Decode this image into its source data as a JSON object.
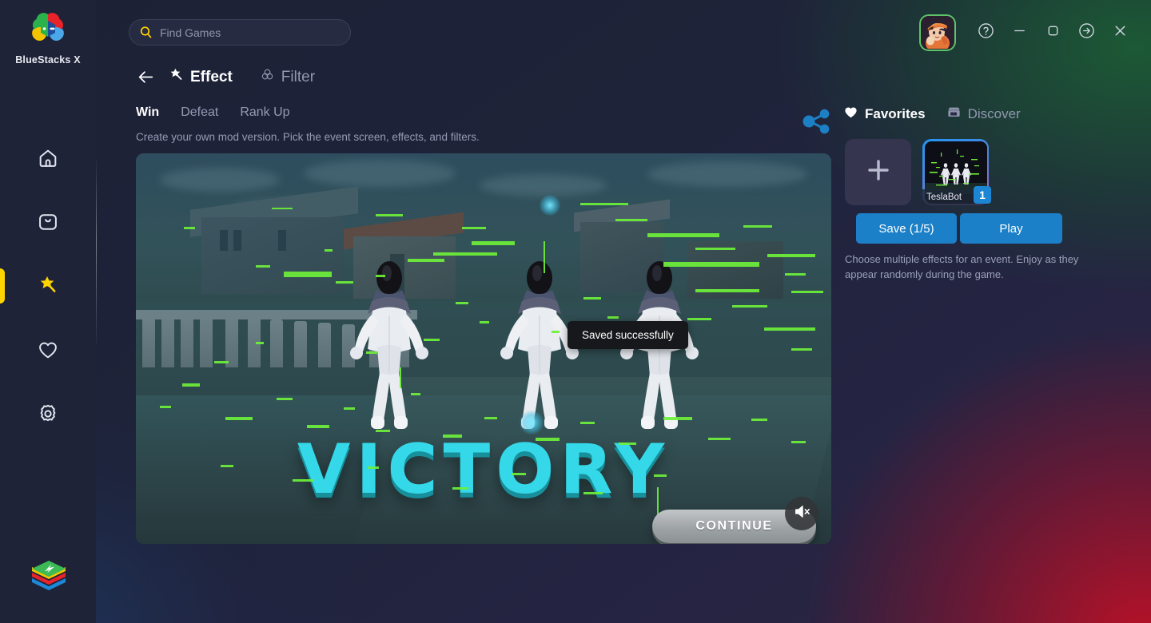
{
  "app": {
    "name": "BlueStacks X",
    "logo_icon": "bluestacks-pinwheel-logo",
    "tray_icon": "bluestacks-stack-icon"
  },
  "search": {
    "placeholder": "Find Games",
    "value": "",
    "icon": "search-icon"
  },
  "window_controls": {
    "avatar_icon": "user-avatar",
    "help_icon": "help-circle-icon",
    "minimize_icon": "minimize-icon",
    "maximize_icon": "maximize-icon",
    "popout_icon": "arrow-right-circle-icon",
    "close_icon": "close-icon"
  },
  "sidebar": {
    "items": [
      {
        "name": "home",
        "icon": "home-icon",
        "active": false
      },
      {
        "name": "store",
        "icon": "bag-icon",
        "active": false
      },
      {
        "name": "effects",
        "icon": "magic-wand-icon",
        "active": true
      },
      {
        "name": "favorites",
        "icon": "heart-icon",
        "active": false
      },
      {
        "name": "settings",
        "icon": "gear-icon",
        "active": false
      }
    ]
  },
  "header": {
    "back_icon": "back-arrow-icon",
    "effect_label": "Effect",
    "effect_icon": "magic-wand-icon",
    "filter_label": "Filter",
    "filter_icon": "venn-circles-icon"
  },
  "tabs": [
    {
      "label": "Win",
      "active": true
    },
    {
      "label": "Defeat",
      "active": false
    },
    {
      "label": "Rank Up",
      "active": false
    }
  ],
  "subtitle": "Create your own mod version. Pick the event screen, effects, and filters.",
  "preview": {
    "victory_text": "VICTORY",
    "continue_label": "CONTINUE",
    "mute_icon": "volume-mute-icon",
    "toast": "Saved successfully"
  },
  "right_panel": {
    "share_icon": "share-icon",
    "tabs": [
      {
        "label": "Favorites",
        "icon": "heart-filled-icon",
        "active": true
      },
      {
        "label": "Discover",
        "icon": "store-icon",
        "active": false
      }
    ],
    "add_card_icon": "plus-icon",
    "effect_cards": [
      {
        "label": "TeslaBot",
        "badge": "1",
        "selected": true
      }
    ],
    "save_label": "Save (1/5)",
    "play_label": "Play",
    "note": "Choose multiple effects for an event. Enjoy as they appear randomly during the game."
  },
  "colors": {
    "accent_yellow": "#ffd400",
    "accent_blue": "#1b80c8",
    "share_blue": "#1d7fc4",
    "avatar_border_green": "#5ec46a",
    "glitch_green": "#6ef03a",
    "victory_cyan": "#35d8e8"
  }
}
